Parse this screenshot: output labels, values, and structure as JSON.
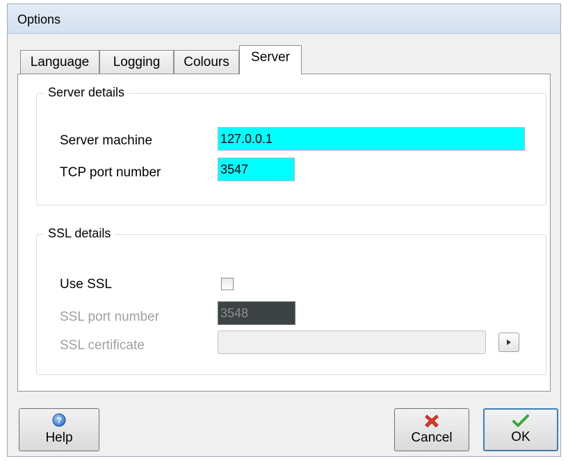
{
  "window": {
    "title": "Options"
  },
  "tabs": [
    {
      "label": "Language"
    },
    {
      "label": "Logging"
    },
    {
      "label": "Colours"
    },
    {
      "label": "Server",
      "active": true
    }
  ],
  "server_details": {
    "legend": "Server details",
    "server_machine_label": "Server machine",
    "server_machine_value": "127.0.0.1",
    "tcp_port_label": "TCP port number",
    "tcp_port_value": "3547"
  },
  "ssl_details": {
    "legend": "SSL details",
    "use_ssl_label": "Use SSL",
    "use_ssl_checked": false,
    "ssl_port_label": "SSL port number",
    "ssl_port_value": "3548",
    "ssl_certificate_label": "SSL certificate",
    "ssl_certificate_value": ""
  },
  "buttons": {
    "help": "Help",
    "cancel": "Cancel",
    "ok": "OK"
  },
  "colors": {
    "field_highlight": "#00ffff",
    "default_button_border": "#3c7fb1"
  }
}
